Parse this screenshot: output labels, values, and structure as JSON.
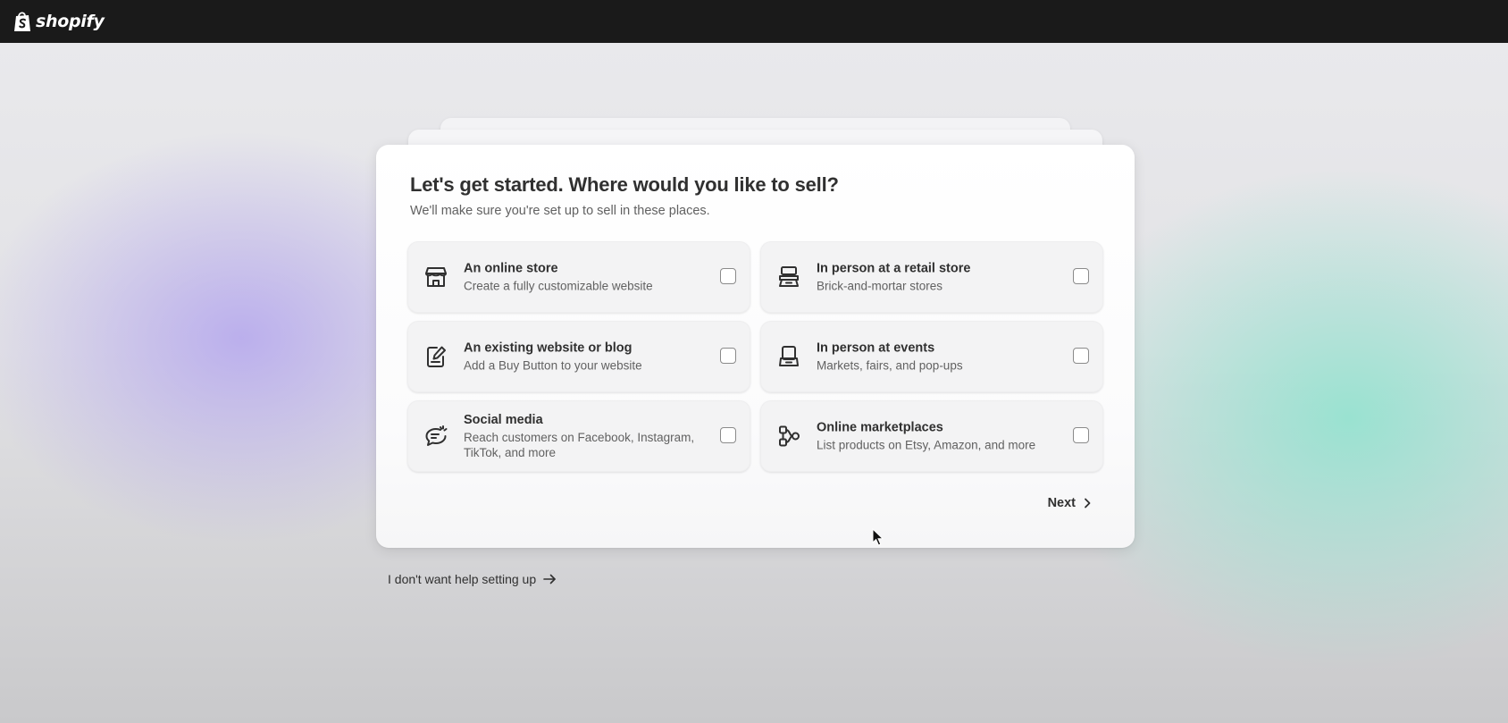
{
  "topbar": {
    "brand": "shopify",
    "logo_icon": "shopify-bag-icon",
    "background": "#1a1a1a"
  },
  "onboarding": {
    "title": "Let's get started. Where would you like to sell?",
    "subtitle": "We'll make sure you're set up to sell in these places.",
    "options": [
      {
        "title": "An online store",
        "description": "Create a fully customizable website",
        "icon": "storefront-icon",
        "checked": false
      },
      {
        "title": "In person at a retail store",
        "description": "Brick-and-mortar stores",
        "icon": "point-of-sale-icon",
        "checked": false
      },
      {
        "title": "An existing website or blog",
        "description": "Add a Buy Button to your website",
        "icon": "note-edit-icon",
        "checked": false
      },
      {
        "title": "In person at events",
        "description": "Markets, fairs, and pop-ups",
        "icon": "card-reader-icon",
        "checked": false
      },
      {
        "title": "Social media",
        "description": "Reach customers on Facebook, Instagram, TikTok, and more",
        "icon": "chat-spark-icon",
        "checked": false
      },
      {
        "title": "Online marketplaces",
        "description": "List products on Etsy, Amazon, and more",
        "icon": "channels-icon",
        "checked": false
      }
    ],
    "next_label": "Next",
    "skip_label": "I don't want help setting up"
  },
  "colors": {
    "text_primary": "#303030",
    "text_secondary": "#616161",
    "accent_lavender": "#b4a6ee",
    "accent_mint": "#96e2d0"
  }
}
